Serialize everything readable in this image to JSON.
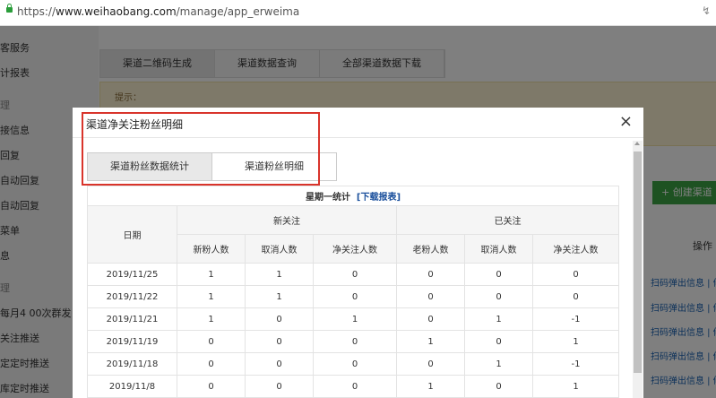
{
  "browser": {
    "url_scheme": "https://",
    "url_host": "www.weihaobang.com",
    "url_path": "/manage/app_erweima"
  },
  "sidebar": {
    "items": [
      "客服务",
      "计报表",
      "理",
      "接信息",
      "回复",
      "自动回复",
      "自动回复",
      "菜单",
      "息",
      "理",
      "每月4 00次群发",
      "关注推送",
      "定定时推送",
      "库定时推送"
    ]
  },
  "bg_tabs": [
    "渠道二维码生成",
    "渠道数据查询",
    "全部渠道数据下载"
  ],
  "bg_notice": "提示：",
  "bg_create_button": "+ 创建渠道",
  "bg_operation_header": "操作",
  "bg_row_links": [
    "扫码弹出信息 | 修",
    "扫码弹出信息 | 修",
    "扫码弹出信息 | 修",
    "扫码弹出信息 | 修",
    "扫码弹出信息 | 修"
  ],
  "modal": {
    "title": "渠道净关注粉丝明细",
    "close": "×",
    "tabs": [
      "渠道粉丝数据统计",
      "渠道粉丝明细"
    ],
    "caption": "星期一统计",
    "caption_link": "[下载报表]",
    "date_header": "日期",
    "group_new": "新关注",
    "group_followed": "已关注",
    "columns": [
      "新粉人数",
      "取消人数",
      "净关注人数",
      "老粉人数",
      "取消人数",
      "净关注人数"
    ],
    "rows": [
      [
        "2019/11/25",
        "1",
        "1",
        "0",
        "0",
        "0",
        "0"
      ],
      [
        "2019/11/22",
        "1",
        "1",
        "0",
        "0",
        "0",
        "0"
      ],
      [
        "2019/11/21",
        "1",
        "0",
        "1",
        "0",
        "1",
        "-1"
      ],
      [
        "2019/11/19",
        "0",
        "0",
        "0",
        "1",
        "0",
        "1"
      ],
      [
        "2019/11/18",
        "0",
        "0",
        "0",
        "0",
        "1",
        "-1"
      ],
      [
        "2019/11/8",
        "0",
        "0",
        "0",
        "1",
        "0",
        "1"
      ]
    ]
  },
  "colors": {
    "highlight_border": "#d9342b",
    "link": "#1a4f9c",
    "create_button": "#3ca545"
  }
}
